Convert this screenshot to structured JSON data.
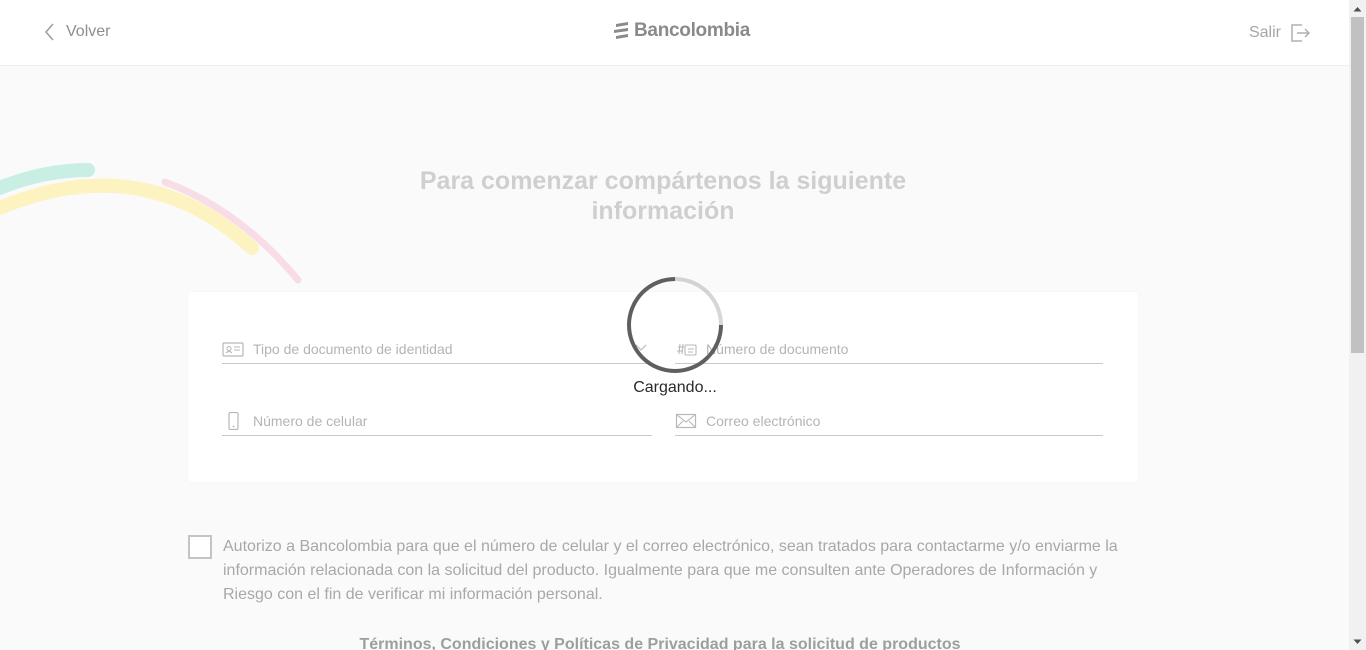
{
  "header": {
    "back_label": "Volver",
    "logo_text": "Bancolombia",
    "exit_label": "Salir"
  },
  "form": {
    "title": "Para comenzar compártenos la siguiente información",
    "fields": {
      "document_type": "Tipo de documento de identidad",
      "document_number": "Número de documento",
      "phone": "Número de celular",
      "email": "Correo electrónico"
    }
  },
  "loader": {
    "text": "Cargando..."
  },
  "consent": {
    "checked": false,
    "text": "Autorizo a Bancolombia para que el número de celular y el correo electrónico, sean tratados para contactarme y/o enviarme la información relacionada con la solicitud del producto. Igualmente para que me consulten ante Operadores de Información y Riesgo con el fin de verificar mi información personal."
  },
  "terms": {
    "text": "Términos, Condiciones y Políticas de Privacidad para la solicitud de productos"
  },
  "colors": {
    "decor_green": "#c9eee4",
    "decor_yellow": "#fdf3c1",
    "decor_pink": "#f8dde6",
    "spinner": "#5f5f5f"
  }
}
